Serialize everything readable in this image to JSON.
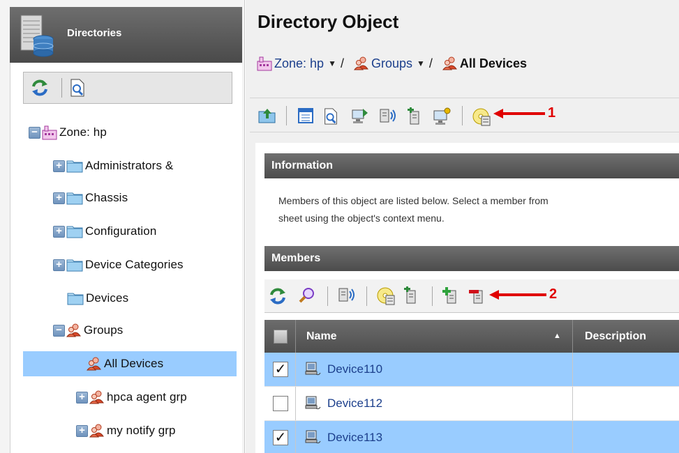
{
  "left_panel": {
    "title": "Directories",
    "tree": [
      {
        "label": "Zone: hp",
        "expander": "−"
      },
      {
        "label": "Administrators &",
        "expander": "+"
      },
      {
        "label": "Chassis",
        "expander": "+"
      },
      {
        "label": "Configuration",
        "expander": "+"
      },
      {
        "label": "Device Categories",
        "expander": "+"
      },
      {
        "label": "Devices",
        "expander": ""
      },
      {
        "label": "Groups",
        "expander": "−"
      },
      {
        "label": "All Devices",
        "expander": ""
      },
      {
        "label": "hpca agent grp",
        "expander": "+"
      },
      {
        "label": "my notify grp",
        "expander": "+"
      }
    ]
  },
  "main": {
    "title": "Directory Object",
    "breadcrumb": {
      "zone": "Zone: hp",
      "groups": "Groups",
      "all_devices": "All Devices",
      "caret": "▼",
      "separator": "/"
    },
    "annotation_1": "1",
    "annotation_2": "2",
    "information": {
      "header": "Information",
      "line1": "Members of this object are listed below. Select a member from",
      "line2": "sheet using the object's context menu."
    },
    "members": {
      "header": "Members",
      "columns": {
        "name": "Name",
        "description": "Description",
        "sort_indicator": "▲"
      },
      "rows": [
        {
          "name": "Device110",
          "checked": true,
          "check_mark": "✓"
        },
        {
          "name": "Device112",
          "checked": false,
          "check_mark": ""
        },
        {
          "name": "Device113",
          "checked": true,
          "check_mark": "✓"
        }
      ]
    }
  },
  "colors": {
    "selection": "#99ccff",
    "link": "#1c3f8c",
    "annotation_arrow": "#e00000",
    "header_bar": "#555555"
  }
}
